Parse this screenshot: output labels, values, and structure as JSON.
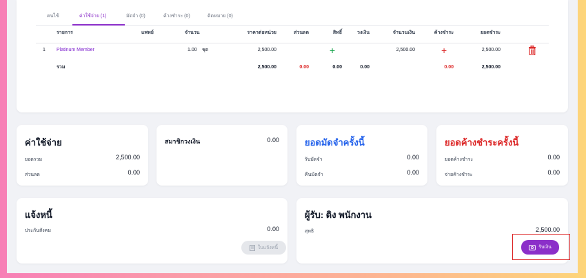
{
  "tabs": [
    {
      "label": "คนไข้",
      "active": false
    },
    {
      "label": "ค่าใช้จ่าย (1)",
      "active": true
    },
    {
      "label": "มัดจำ (0)",
      "active": false
    },
    {
      "label": "ค้างชำระ (0)",
      "active": false
    },
    {
      "label": "ติดหมาย (0)",
      "active": false
    }
  ],
  "table": {
    "headers": {
      "item": "รายการ",
      "doctor": "แพทย์",
      "qty": "จำนวน",
      "unit_price": "ราคาต่อหน่วย",
      "discount": "ส่วนลด",
      "rights": "สิทธิ์",
      "cash": "วงเงิน",
      "amount": "จำนวนเงิน",
      "outstanding": "ค้างชำระ",
      "total": "ยอดชำระ"
    },
    "rows": [
      {
        "no": "1",
        "item": "Platinum Member",
        "qty": "1.00",
        "unit": "ชุด",
        "unit_price": "2,500.00",
        "amount": "2,500.00",
        "total": "2,500.00"
      }
    ],
    "sum": {
      "label": "รวม",
      "unit_price": "2,500.00",
      "discount": "0.00",
      "rights": "0.00",
      "cash": "0.00",
      "outstanding": "0.00",
      "total": "2,500.00"
    }
  },
  "expenses": {
    "title": "ค่าใช้จ่าย",
    "total_label": "ยอดรวม",
    "total_value": "2,500.00",
    "discount_label": "ส่วนลด",
    "discount_value": "0.00"
  },
  "member": {
    "title": "สมาชิกวงเงิน",
    "value": "0.00"
  },
  "deposit": {
    "title": "ยอดมัดจำครั้งนี้",
    "receive_label": "รับมัดจำ",
    "receive_value": "0.00",
    "refund_label": "คืนมัดจำ",
    "refund_value": "0.00"
  },
  "outstanding": {
    "title": "ยอดค้างชำระครั้งนี้",
    "balance_label": "ยอดค้างชำระ",
    "balance_value": "0.00",
    "pay_label": "จ่ายค้างชำระ",
    "pay_value": "0.00"
  },
  "notice": {
    "title": "แจ้งหนี้",
    "fee_label": "ประกันสังคม",
    "fee_value": "0.00",
    "button_label": "ใบแจ้งหนี้"
  },
  "payer": {
    "title": "ผู้รับ: ดิง พนักงาน",
    "net_label": "สุทธิ",
    "net_value": "2,500.00",
    "button_label": "รับเงิน"
  },
  "colors": {
    "accent": "#8b2fc9",
    "blue_title": "#2563eb",
    "red": "#dc2626",
    "green": "#16a34a"
  }
}
